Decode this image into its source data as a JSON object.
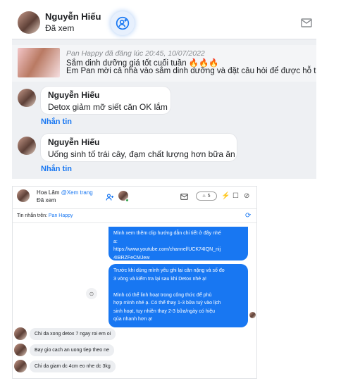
{
  "panel1": {
    "user_name": "Nguyễn Hiếu",
    "status": "Đã xem",
    "post": {
      "meta": "Pan Happy đã đăng lúc 20:45, 10/07/2022",
      "title": "Sắm dinh dưỡng giá tốt cuối tuần 🔥🔥🔥",
      "desc": "Em Pan mời cả nhà vào sắm dinh dưỡng và đặt câu hỏi để được hỗ trợ cá"
    },
    "messages": [
      {
        "name": "Nguyễn Hiếu",
        "text": "Detox giảm mỡ siết căn OK lắm",
        "reply": "Nhắn tin"
      },
      {
        "name": "Nguyễn Hiếu",
        "text": "Uống sinh tố trái cây, đạm chất lượng hơn bữa ăn",
        "reply": "Nhắn tin"
      }
    ]
  },
  "panel2": {
    "user_name": "Hoa Lâm",
    "view_link": "@Xem trang",
    "status": "Đã xem",
    "badge_count": "5",
    "sub_label": "Tin nhắn trên:",
    "page_name": "Pan Happy",
    "sent_messages": [
      "Mình xem thêm clip hướng dẫn chi tiết ở đây nhé\na:\nhttps://www.youtube.com/channel/UCK74IQN_nij\n4IBRZFeCMJew",
      "Trước khi dùng mình yêu ghi lại cân nặng và số đo\n3 vòng và kiểm tra lại sau khi Detox nhé ạ!\n\nMình có thể linh hoạt trong công thức để phù\nhợp mình nhé ạ. Có thể thay 1-3 bữa tuỳ vào lịch\nsinh hoạt, tuy nhiên thay 2-3 bữa/ngày có hiệu\nqủa nhanh hơn ạ!"
    ],
    "received_messages": [
      "Chi da xong detox 7 ngay roi em oi",
      "Bay gio cach an uong tiep theo ne",
      "Chi da giam dc 4cm eo nhe dc 3kg"
    ]
  },
  "colors": {
    "accent": "#1877f2",
    "bubble_received": "#eceef1"
  }
}
